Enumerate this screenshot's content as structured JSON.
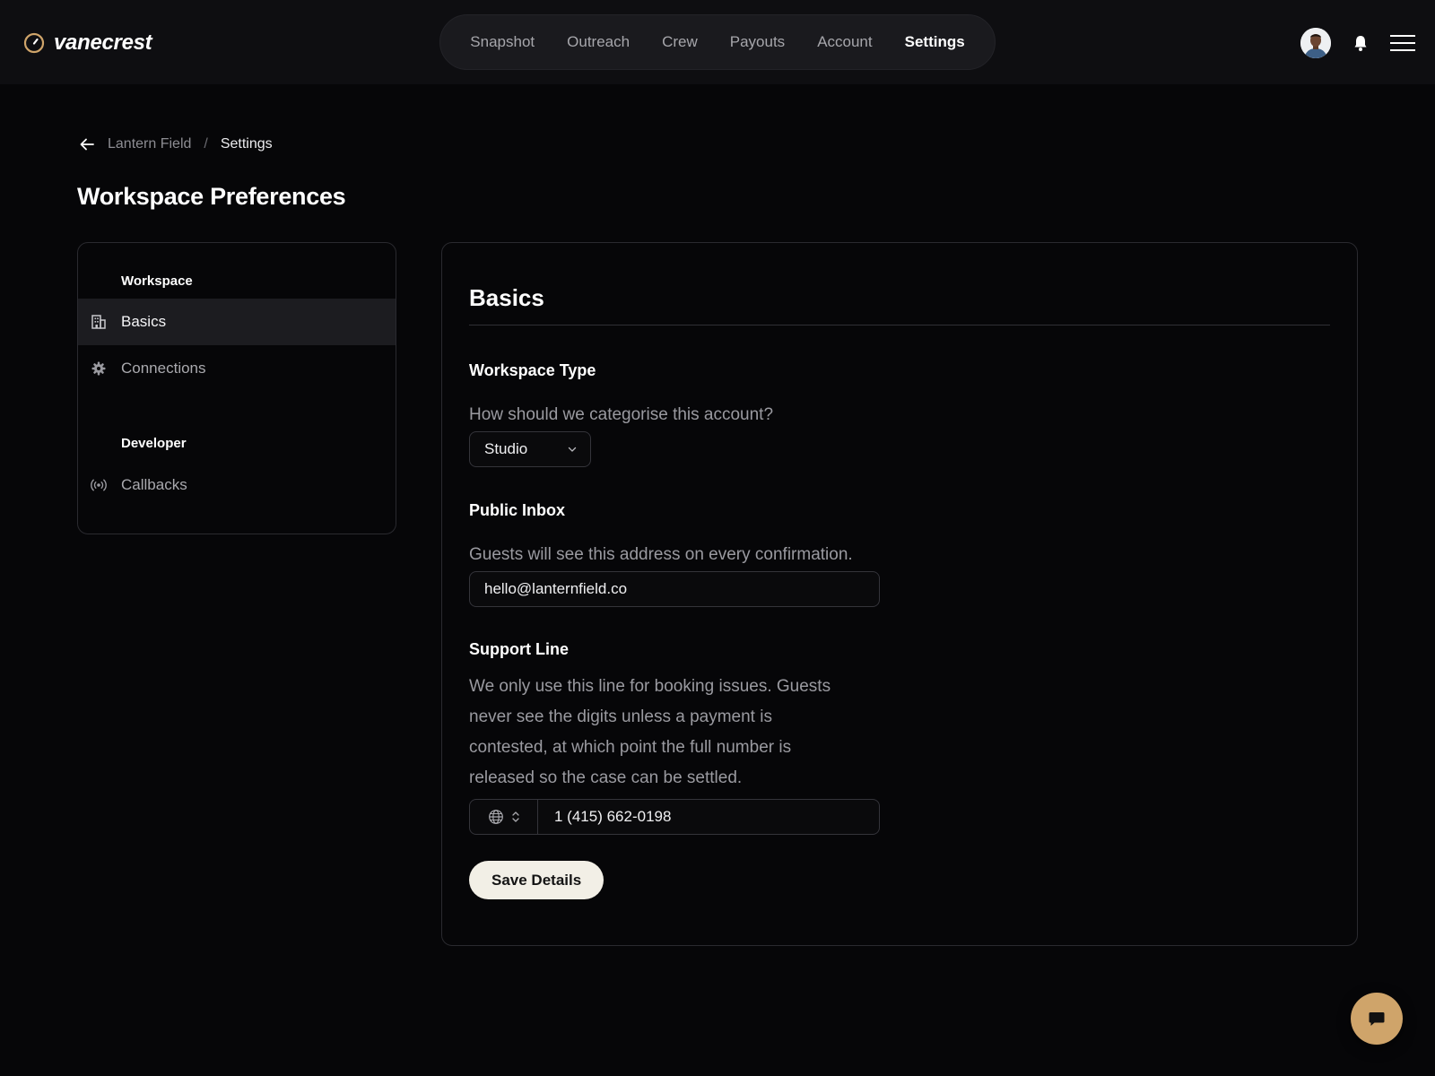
{
  "brand": {
    "name": "vanecrest",
    "accent": "#cfa46a"
  },
  "nav": {
    "items": [
      {
        "label": "Snapshot",
        "active": false
      },
      {
        "label": "Outreach",
        "active": false
      },
      {
        "label": "Crew",
        "active": false
      },
      {
        "label": "Payouts",
        "active": false
      },
      {
        "label": "Account",
        "active": false
      },
      {
        "label": "Settings",
        "active": true
      }
    ]
  },
  "header_icons": {
    "avatar": "user-avatar",
    "bell": "bell-icon",
    "menu": "hamburger-menu-icon"
  },
  "breadcrumb": {
    "back_icon": "arrow-left-icon",
    "parent": "Lantern Field",
    "separator": "/",
    "current": "Settings"
  },
  "page": {
    "title": "Workspace Preferences"
  },
  "sidebar": {
    "groups": [
      {
        "label": "Workspace",
        "items": [
          {
            "label": "Basics",
            "icon": "building-icon",
            "active": true
          },
          {
            "label": "Connections",
            "icon": "gear-icon",
            "active": false
          }
        ]
      },
      {
        "label": "Developer",
        "items": [
          {
            "label": "Callbacks",
            "icon": "broadcast-icon",
            "active": false
          }
        ]
      }
    ]
  },
  "form": {
    "section_title": "Basics",
    "workspace_type": {
      "label": "Workspace Type",
      "help": "How should we categorise this account?",
      "selected": "Studio"
    },
    "public_inbox": {
      "label": "Public Inbox",
      "help": "Guests will see this address on every confirmation.",
      "value": "hello@lanternfield.co"
    },
    "support_line": {
      "label": "Support Line",
      "help_lines": [
        "We only use this line for booking issues. Guests",
        "never see the digits unless a payment is",
        "contested, at which point the full number is",
        "released so the case can be settled."
      ],
      "country_icon": "globe-icon",
      "value": "1 (415) 662-0198"
    },
    "save_label": "Save Details"
  },
  "chat": {
    "icon": "chat-bubble-icon"
  }
}
